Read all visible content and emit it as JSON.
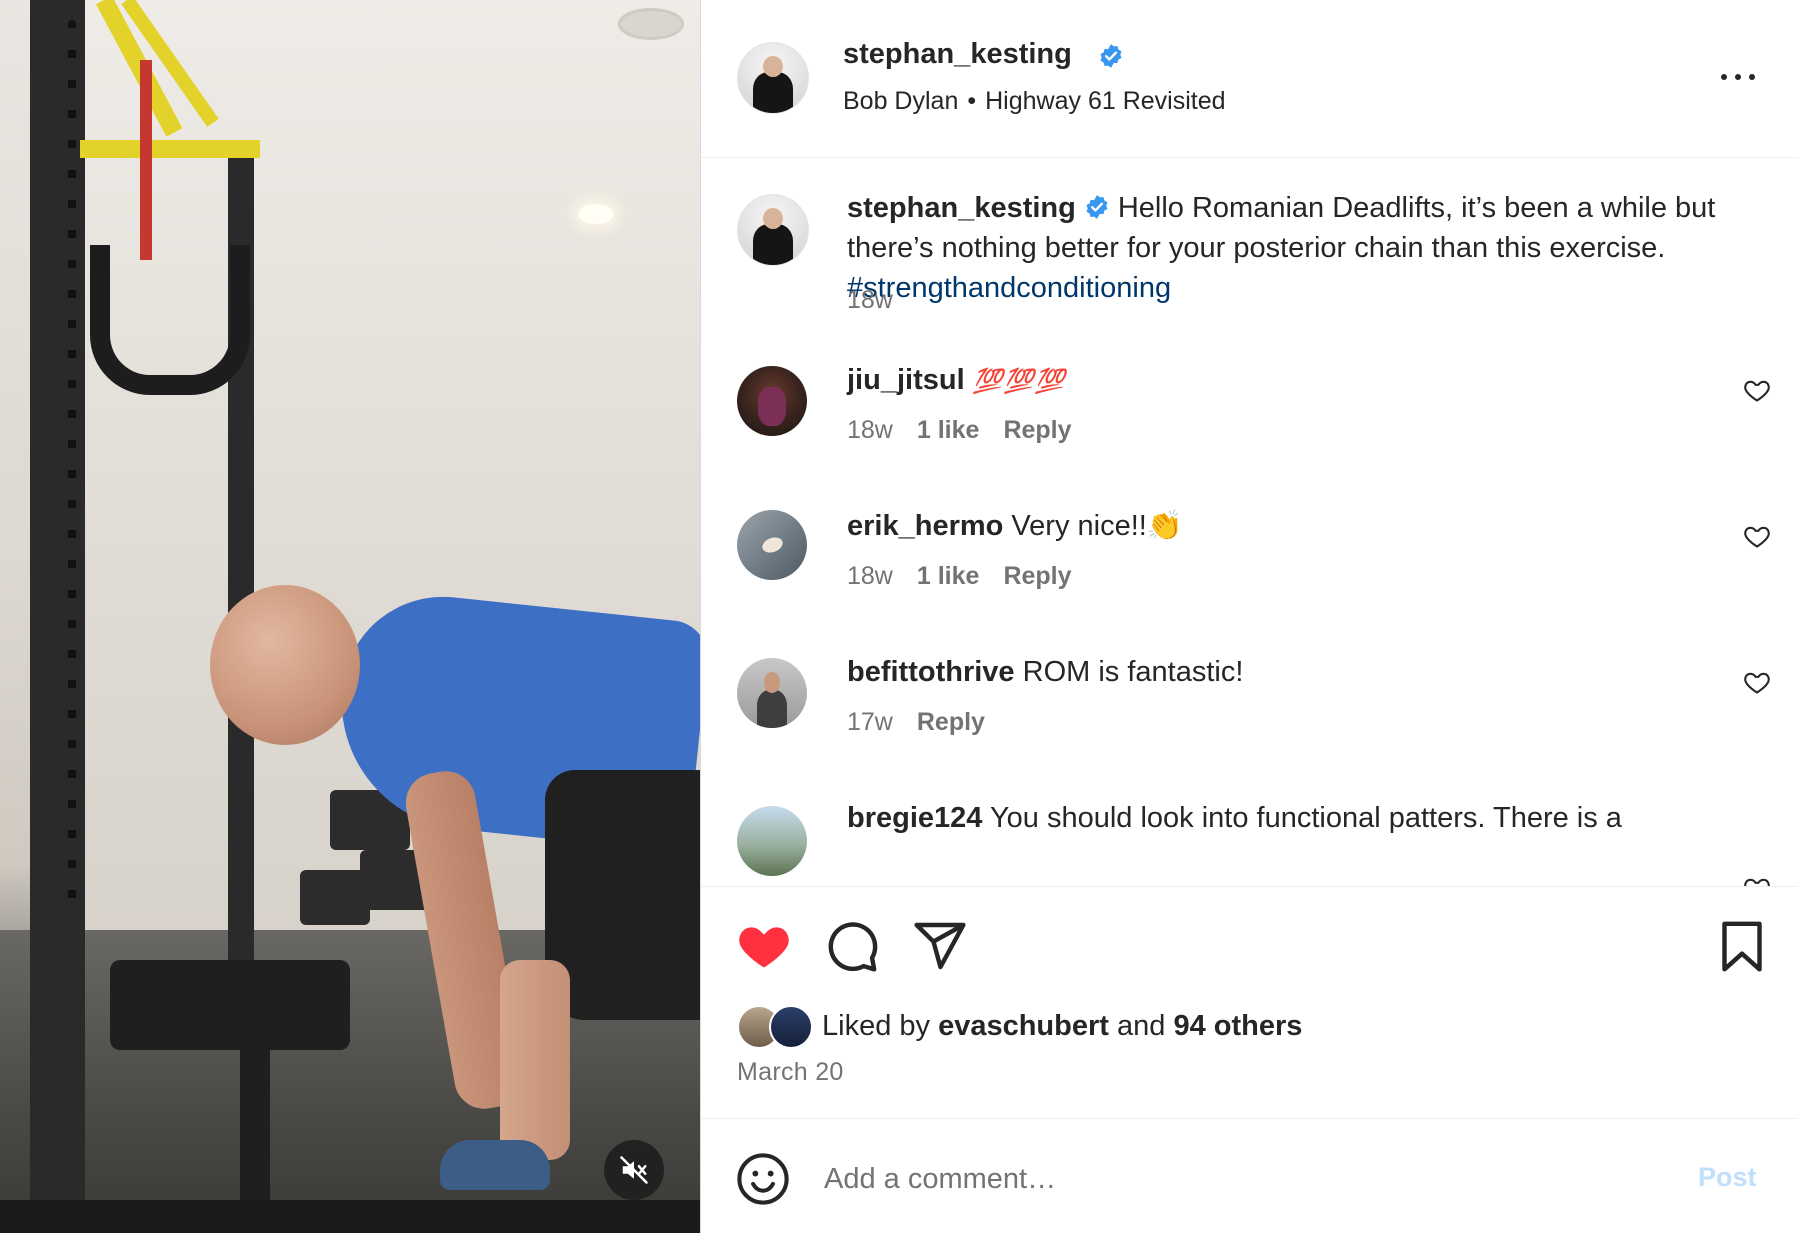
{
  "post": {
    "owner_username": "stephan_kesting",
    "audio_artist": "Bob Dylan",
    "audio_separator": "•",
    "audio_title": "Highway 61 Revisited",
    "more_icon": "more-horizontal-icon",
    "mute_icon": "speaker-muted-icon",
    "verified_icon": "verified-badge-icon",
    "verified_color": "#3897f0"
  },
  "caption": {
    "username": "stephan_kesting",
    "text": "Hello Romanian Deadlifts, it’s been a while but there’s nothing better for your posterior chain than this exercise.",
    "hashtag": "#strengthandconditioning",
    "time": "18w"
  },
  "comments": [
    {
      "username": "jiu_jitsul",
      "text": "💯💯💯",
      "time": "18w",
      "likes": "1 like",
      "reply": "Reply"
    },
    {
      "username": "erik_hermo",
      "text": "Very nice!!👏",
      "time": "18w",
      "likes": "1 like",
      "reply": "Reply"
    },
    {
      "username": "befittothrive",
      "text": "ROM is fantastic!",
      "time": "17w",
      "likes": "",
      "reply": "Reply"
    },
    {
      "username": "bregie124",
      "text": "You should look into functional patters. There is a",
      "time": "",
      "likes": "",
      "reply": ""
    }
  ],
  "actions": {
    "like_icon": "heart-filled-icon",
    "like_color": "#ff3040",
    "comment_icon": "comment-bubble-icon",
    "share_icon": "paper-plane-icon",
    "save_icon": "bookmark-icon"
  },
  "likes": {
    "prefix": "Liked by",
    "user": "evaschubert",
    "joiner": "and",
    "others": "94 others"
  },
  "date": "March 20",
  "composer": {
    "emoji_icon": "smiley-icon",
    "placeholder": "Add a comment…",
    "post_label": "Post",
    "post_color": "#c0dffd"
  }
}
